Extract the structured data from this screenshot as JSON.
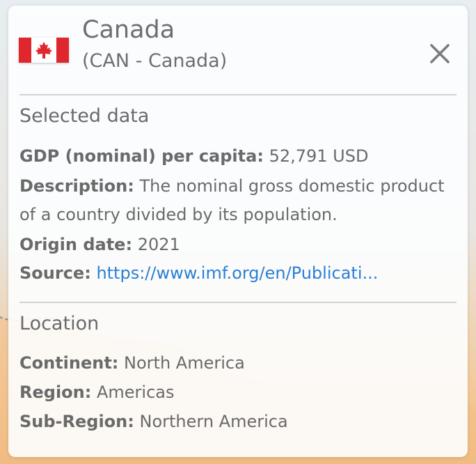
{
  "header": {
    "country_name": "Canada",
    "country_sub": "(CAN - Canada)",
    "flag_icon": "canada-flag-icon",
    "close_icon": "close-icon"
  },
  "selected_data": {
    "title": "Selected data",
    "gdp_label": "GDP (nominal) per capita:",
    "gdp_value": "52,791 USD",
    "description_label": "Description:",
    "description_value": "The nominal gross domestic product of a country divided by its population.",
    "origin_label": "Origin date:",
    "origin_value": "2021",
    "source_label": "Source:",
    "source_value": "https://www.imf.org/en/Publicati..."
  },
  "location": {
    "title": "Location",
    "continent_label": "Continent:",
    "continent_value": "North America",
    "region_label": "Region:",
    "region_value": "Americas",
    "subregion_label": "Sub-Region:",
    "subregion_value": "Northern America"
  },
  "colors": {
    "flag_red": "#e0272e",
    "link": "#2a7fd4",
    "text": "#6a6a6a"
  }
}
